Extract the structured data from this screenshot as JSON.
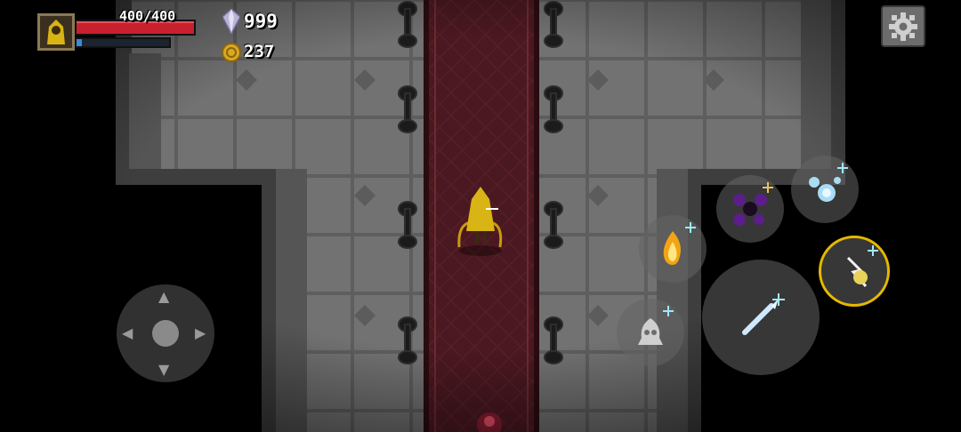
{
  "hud": {
    "hp_text": "400/400",
    "hp_fraction": 1.0,
    "mp_fraction": 0.06,
    "gem_count": "999",
    "coin_count": "237"
  },
  "colors": {
    "hp": "#c9202f",
    "mp": "#3b8ad8",
    "carpet": "#4a1820",
    "floor": "#6e6e6e",
    "active_ring": "#e6b800"
  },
  "icons": {
    "portrait": "hooded-hero-icon",
    "gem": "crystal-gem-icon",
    "coin": "gold-coin-icon",
    "settings": "gear-icon",
    "skills": [
      "ice-burst-icon",
      "shadow-void-icon",
      "fire-skill-icon",
      "lightning-skill-icon",
      "spirit-skill-icon",
      "ice-spear-icon"
    ]
  }
}
